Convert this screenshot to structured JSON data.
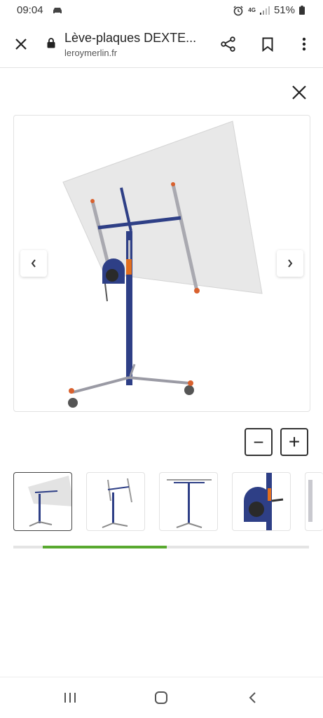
{
  "status_bar": {
    "time": "09:04",
    "network": "4G",
    "battery": "51%"
  },
  "browser": {
    "title": "Lève-plaques DEXTE...",
    "url": "leroymerlin.fr",
    "icons": [
      "close-icon",
      "lock-icon",
      "share-icon",
      "bookmark-icon",
      "more-vert-icon"
    ]
  },
  "gallery": {
    "thumbnail_count": 5,
    "active_thumbnail": 1,
    "scroll_progress": 0.42,
    "accent_color": "#58a92f"
  },
  "zoom": {
    "out_symbol": "−",
    "in_symbol": "+"
  }
}
